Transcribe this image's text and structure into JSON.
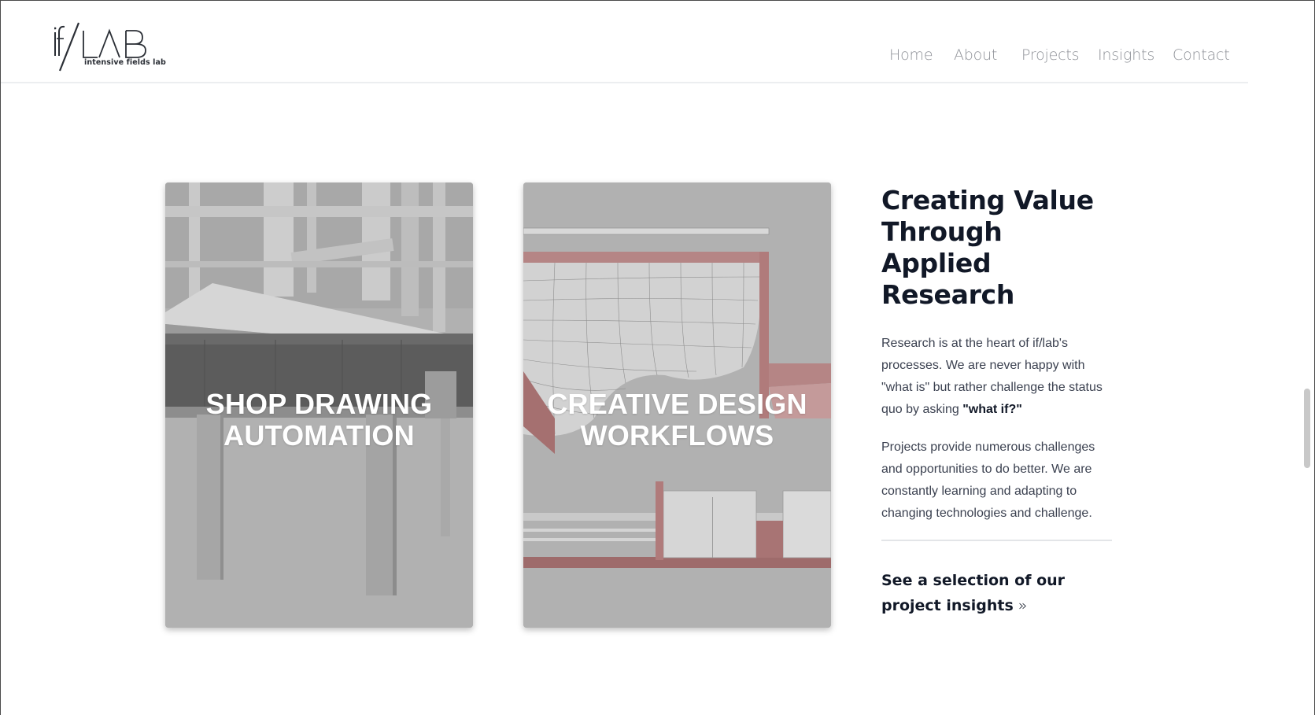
{
  "brand": {
    "logo_mark": "if/LAB",
    "logo_tagline": "intensive fields lab"
  },
  "nav": {
    "items": [
      {
        "label": "Home"
      },
      {
        "label": "About"
      },
      {
        "label": "Projects"
      },
      {
        "label": "Insights"
      },
      {
        "label": "Contact"
      }
    ]
  },
  "cards": [
    {
      "title_line1": "SHOP DRAWING",
      "title_line2": "AUTOMATION",
      "image": "facade-structure-render"
    },
    {
      "title_line1": "CREATIVE DESIGN",
      "title_line2": "WORKFLOWS",
      "image": "curved-ceiling-mesh-render"
    }
  ],
  "research": {
    "heading": "Creating Value Through Applied Research",
    "para1": "Research is at the heart of if/lab's processes. We are never happy with \"what is\" but rather challenge the status quo by asking ",
    "para1_emphasis": "\"what if?\"",
    "para2": "Projects provide numerous challenges and opportunities to do better. We are constantly learning and adapting to changing technologies and challenge.",
    "cta_label": "See a selection of our project insights",
    "cta_icon": "double-chevron-right-icon"
  },
  "colors": {
    "heading": "#111827",
    "body_text": "#3b4150",
    "nav_text": "#8f9298",
    "accent_render": "#b58585"
  }
}
